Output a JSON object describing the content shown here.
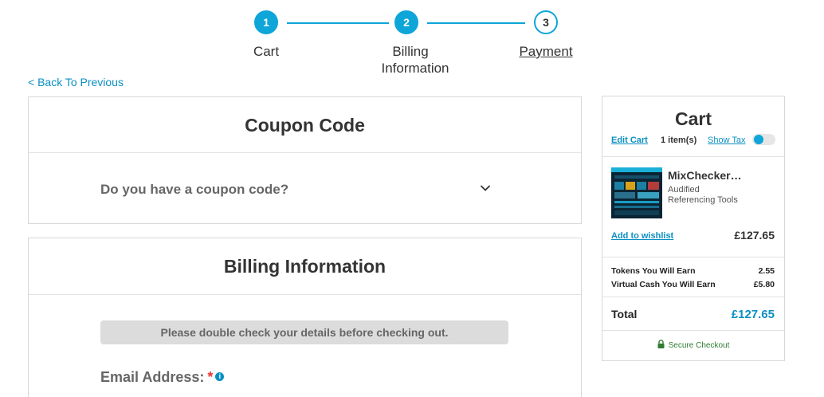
{
  "stepper": {
    "steps": [
      {
        "number": "1",
        "label": "Cart"
      },
      {
        "number": "2",
        "label_line1": "Billing",
        "label_line2": "Information"
      },
      {
        "number": "3",
        "label": "Payment"
      }
    ]
  },
  "back_link": "< Back To Previous",
  "coupon": {
    "title": "Coupon Code",
    "question": "Do you have a coupon code?"
  },
  "billing": {
    "title": "Billing Information",
    "notice": "Please double check your details before checking out.",
    "email_label": "Email Address:",
    "required_mark": "*",
    "info_icon": "i"
  },
  "cart": {
    "title": "Cart",
    "edit_link": "Edit Cart",
    "item_count": "1 item(s)",
    "show_tax": "Show Tax",
    "product": {
      "name": "MixChecker…",
      "brand": "Audified",
      "category": "Referencing Tools",
      "wishlist_link": "Add to wishlist",
      "price": "£127.65"
    },
    "earn": {
      "tokens_label": "Tokens You Will Earn",
      "tokens_value": "2.55",
      "cash_label": "Virtual Cash You Will Earn",
      "cash_value": "£5.80"
    },
    "total_label": "Total",
    "total_value": "£127.65",
    "secure_checkout": "Secure Checkout"
  },
  "colors": {
    "accent": "#0ea5d8",
    "link": "#0a8fc2",
    "secure": "#2e7d32",
    "required": "#e53935"
  }
}
